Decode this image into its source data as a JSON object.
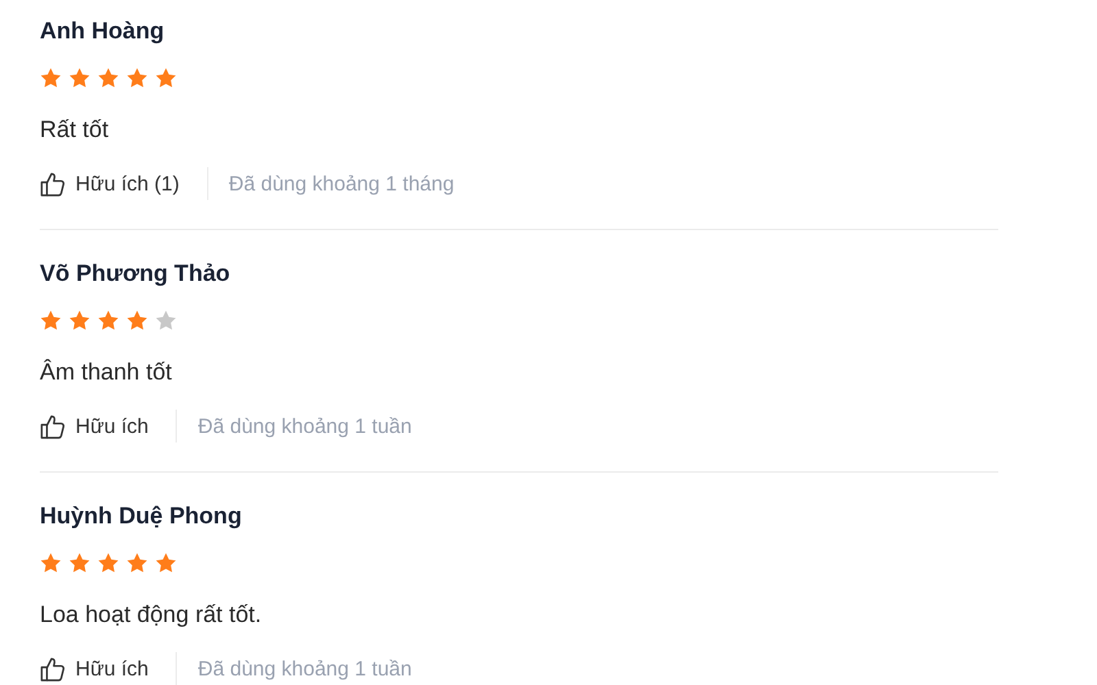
{
  "reviews": [
    {
      "name": "Anh Hoàng",
      "stars": 5,
      "comment": "Rất tốt",
      "helpful": "Hữu ích (1)",
      "usage": "Đã dùng khoảng 1 tháng"
    },
    {
      "name": "Võ Phương Thảo",
      "stars": 4,
      "comment": "Âm thanh tốt",
      "helpful": "Hữu ích",
      "usage": "Đã dùng khoảng 1 tuần"
    },
    {
      "name": "Huỳnh Duệ Phong",
      "stars": 5,
      "comment": "Loa hoạt động rất tốt.",
      "helpful": "Hữu ích",
      "usage": "Đã dùng khoảng 1 tuần"
    }
  ]
}
